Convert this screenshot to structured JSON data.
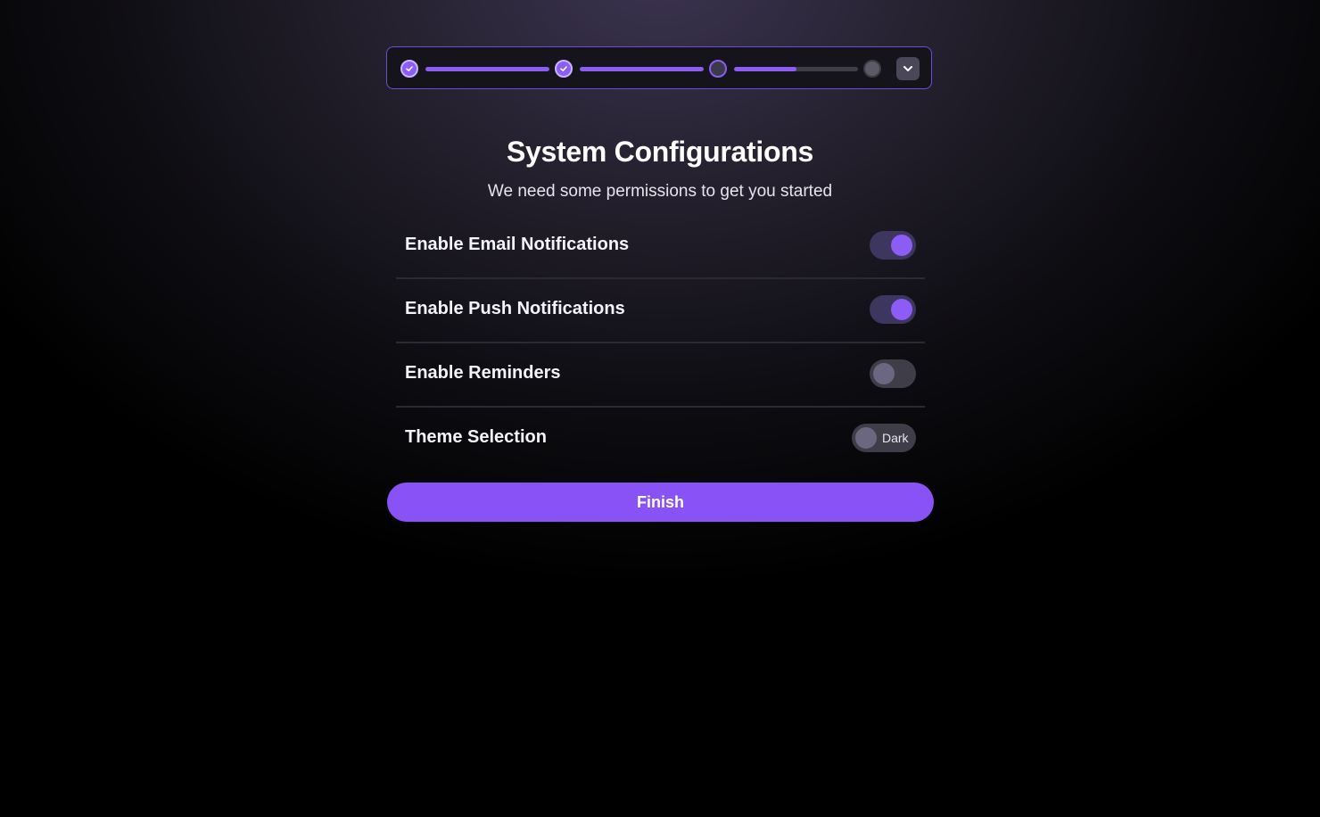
{
  "stepper": {
    "steps": [
      {
        "status": "complete",
        "icon": "check-icon"
      },
      {
        "status": "complete",
        "icon": "check-icon"
      },
      {
        "status": "current"
      },
      {
        "status": "pending"
      }
    ],
    "connector_progress": [
      1.0,
      1.0,
      0.5
    ],
    "expand_icon": "chevron-down-icon"
  },
  "header": {
    "title": "System Configurations",
    "subtitle": "We need some permissions to get you started"
  },
  "settings": [
    {
      "label": "Enable Email Notifications",
      "enabled": true
    },
    {
      "label": "Enable Push Notifications",
      "enabled": true
    },
    {
      "label": "Enable Reminders",
      "enabled": false
    }
  ],
  "theme": {
    "label": "Theme Selection",
    "value": "Dark"
  },
  "actions": {
    "finish_label": "Finish"
  },
  "colors": {
    "accent": "#8b5cf6",
    "button": "#8852f7",
    "toggle_on_track": "#3d3760",
    "toggle_off_track": "#3e3d48"
  }
}
